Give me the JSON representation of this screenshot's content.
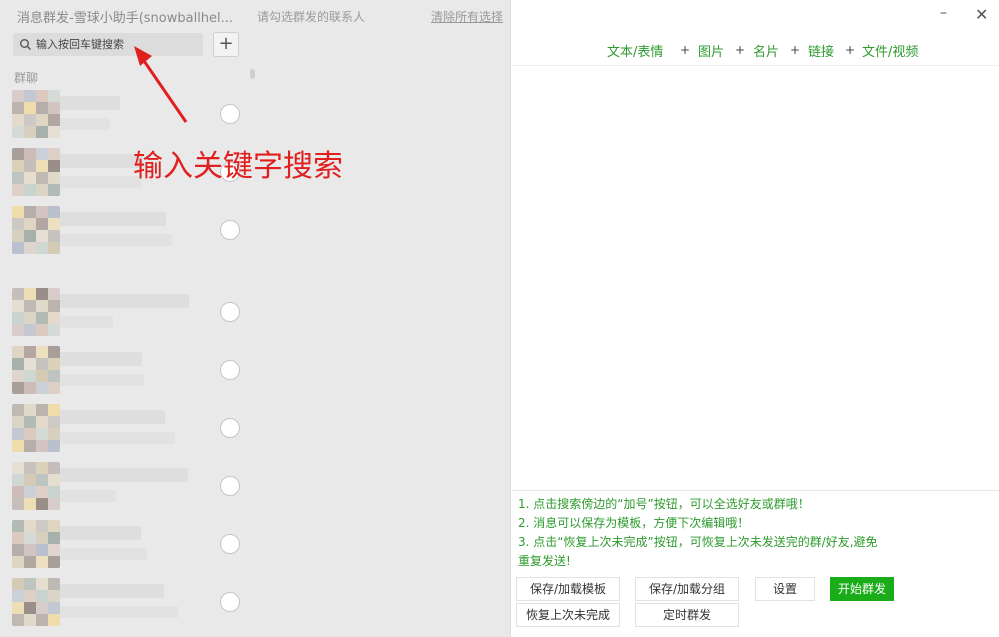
{
  "window": {
    "title": "消息群发-雪球小助手(snowballhel...",
    "hint": "请勾选群发的联系人",
    "clear_all": "清除所有选择",
    "minimize_glyph": "–",
    "close_glyph": "✕"
  },
  "search": {
    "placeholder": "输入按回车键搜索",
    "add_label": "+"
  },
  "list": {
    "section_label": "群聊",
    "row_count": 9
  },
  "annotation": {
    "text": "输入关键字搜索",
    "color": "#e02020"
  },
  "toolbar": {
    "items": [
      "文本/表情",
      "图片",
      "名片",
      "链接",
      "文件/视频"
    ],
    "separator": "+"
  },
  "tips": [
    "1. 点击搜索傍边的“加号”按钮，可以全选好友或群哦！",
    "2. 消息可以保存为模板，方便下次编辑哦！",
    "3. 点击“恢复上次未完成”按钮，可恢复上次未发送完的群/好友,避免重复发送!"
  ],
  "buttons": {
    "save_template": "保存/加载模板",
    "save_group": "保存/加载分组",
    "settings": "设置",
    "start": "开始群发",
    "restore": "恢复上次未完成",
    "schedule": "定时群发"
  },
  "colors": {
    "accent_green": "#2e9b2e",
    "primary_button": "#1aad19",
    "annotation_red": "#e02020"
  }
}
